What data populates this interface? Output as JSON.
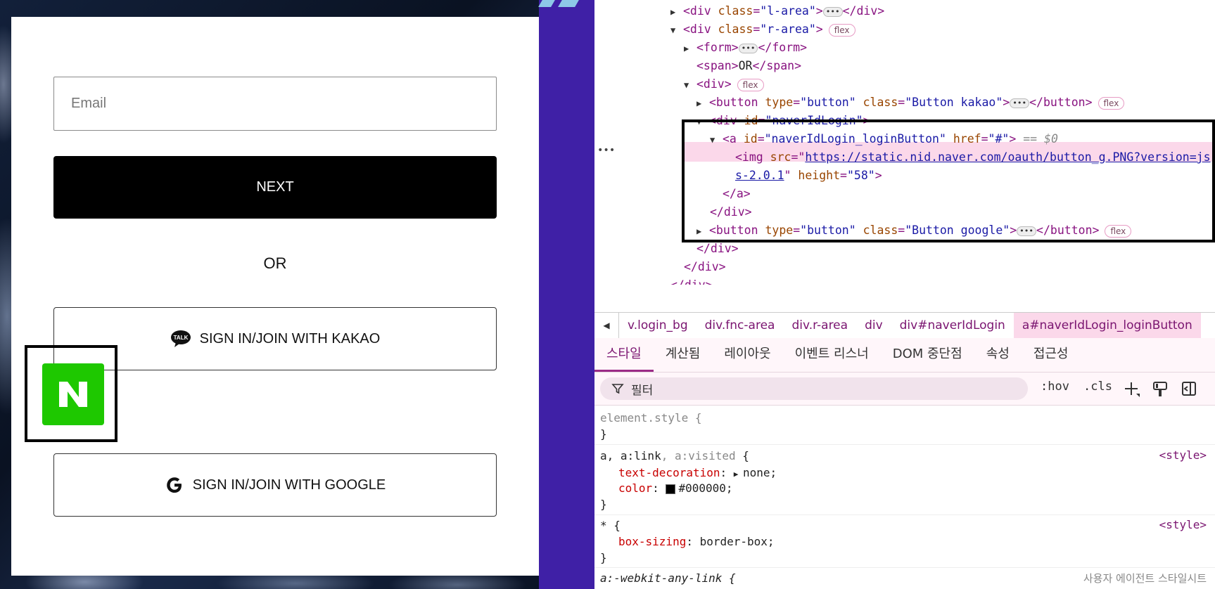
{
  "login": {
    "email_placeholder": "Email",
    "next_label": "NEXT",
    "or_label": "OR",
    "kakao_label": "SIGN IN/JOIN WITH KAKAO",
    "kakao_icon_text": "TALK",
    "naver_letter": "N",
    "google_label": "SIGN IN/JOIN WITH GOOGLE"
  },
  "colors": {
    "naver_green": "#1ec800",
    "devtools_accent": "#7a1470",
    "selected_row": "#fbd8ea"
  },
  "elements_tree": {
    "l1": {
      "tag_open": "<div ",
      "attr": "class",
      "val": "\"l-area\"",
      "close": "</div>"
    },
    "l2": {
      "tag_open": "<div ",
      "attr": "class",
      "val": "\"r-area\"",
      "badge": "flex"
    },
    "l3": {
      "open": "<form>",
      "close": "</form>"
    },
    "l4": {
      "open": "<span>",
      "text": "OR",
      "close": "</span>"
    },
    "l5": {
      "open": "<div>",
      "badge": "flex"
    },
    "l6": {
      "tag_open": "<button ",
      "a1": "type",
      "v1": "\"button\"",
      "a2": "class",
      "v2": "\"Button kakao\"",
      "close": "</button>",
      "badge": "flex"
    },
    "l7": {
      "tag_open": "<div ",
      "attr": "id",
      "val": "\"naverIdLogin\""
    },
    "l8": {
      "tag_open": "<a ",
      "a1": "id",
      "v1": "\"naverIdLogin_loginButton\"",
      "a2": "href",
      "v2": "\"#\"",
      "eq": "== $0"
    },
    "l9": {
      "tag_open": "<img ",
      "attr": "src",
      "url1": "https://static.nid.naver.com/oauth/button_g.PNG?version=js"
    },
    "l10": {
      "url2": "s-2.0.1",
      "a2": "height",
      "v2": "\"58\""
    },
    "l11": {
      "close": "</a>"
    },
    "l12": {
      "close": "</div>"
    },
    "l13": {
      "tag_open": "<button ",
      "a1": "type",
      "v1": "\"button\"",
      "a2": "class",
      "v2": "\"Button google\"",
      "close": "</button>",
      "badge": "flex"
    },
    "l14": {
      "close": "</div>"
    },
    "l15": {
      "close": "</div>"
    },
    "l16": {
      "close": "</div>"
    }
  },
  "breadcrumbs": [
    "v.login_bg",
    "div.fnc-area",
    "div.r-area",
    "div",
    "div#naverIdLogin",
    "a#naverIdLogin_loginButton"
  ],
  "tabs": [
    "스타일",
    "계산됨",
    "레이아웃",
    "이벤트 리스너",
    "DOM 중단점",
    "속성",
    "접근성"
  ],
  "filter": {
    "placeholder": "필터",
    "hov": ":hov",
    "cls": ".cls"
  },
  "styles": {
    "element_style": "element.style {",
    "close_brace": "}",
    "rule2_sel_a": "a, a:link",
    "rule2_sel_b": ", a:visited",
    "rule2_open": " {",
    "rule2_p1": "text-decoration",
    "rule2_v1": "none;",
    "rule2_p2": "color",
    "rule2_v2": "#000000;",
    "rule3_sel": "* {",
    "rule3_p1": "box-sizing",
    "rule3_v1": "border-box;",
    "rule4_sel": "a:-webkit-any-link {",
    "rule4_src": "사용자 에이전트 스타일시트",
    "src_label": "<style>"
  }
}
